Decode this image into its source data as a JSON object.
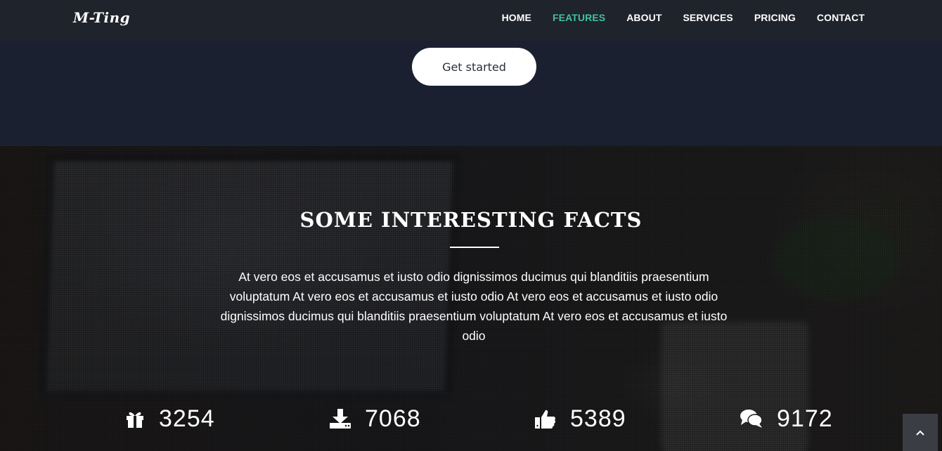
{
  "brand": "M-Ting",
  "nav": [
    {
      "label": "HOME",
      "active": false
    },
    {
      "label": "FEATURES",
      "active": true
    },
    {
      "label": "ABOUT",
      "active": false
    },
    {
      "label": "SERVICES",
      "active": false
    },
    {
      "label": "PRICING",
      "active": false
    },
    {
      "label": "CONTACT",
      "active": false
    }
  ],
  "hero": {
    "cta_label": "Get started"
  },
  "facts": {
    "title": "SOME INTERESTING FACTS",
    "description": "At vero eos et accusamus et iusto odio dignissimos ducimus qui blanditiis praesentium voluptatum At vero eos et accusamus et iusto odio At vero eos et accusamus et iusto odio dignissimos ducimus qui blanditiis praesentium voluptatum At vero eos et accusamus et iusto odio",
    "stats": [
      {
        "icon": "gift-icon",
        "value": "3254"
      },
      {
        "icon": "download-icon",
        "value": "7068"
      },
      {
        "icon": "thumbs-up-icon",
        "value": "5389"
      },
      {
        "icon": "comments-icon",
        "value": "9172"
      }
    ]
  },
  "back_to_top_icon": "chevron-up-icon",
  "colors": {
    "accent": "#3fc1a5",
    "nav_bg": "#1f232b",
    "hero_bg": "#1b2031"
  }
}
